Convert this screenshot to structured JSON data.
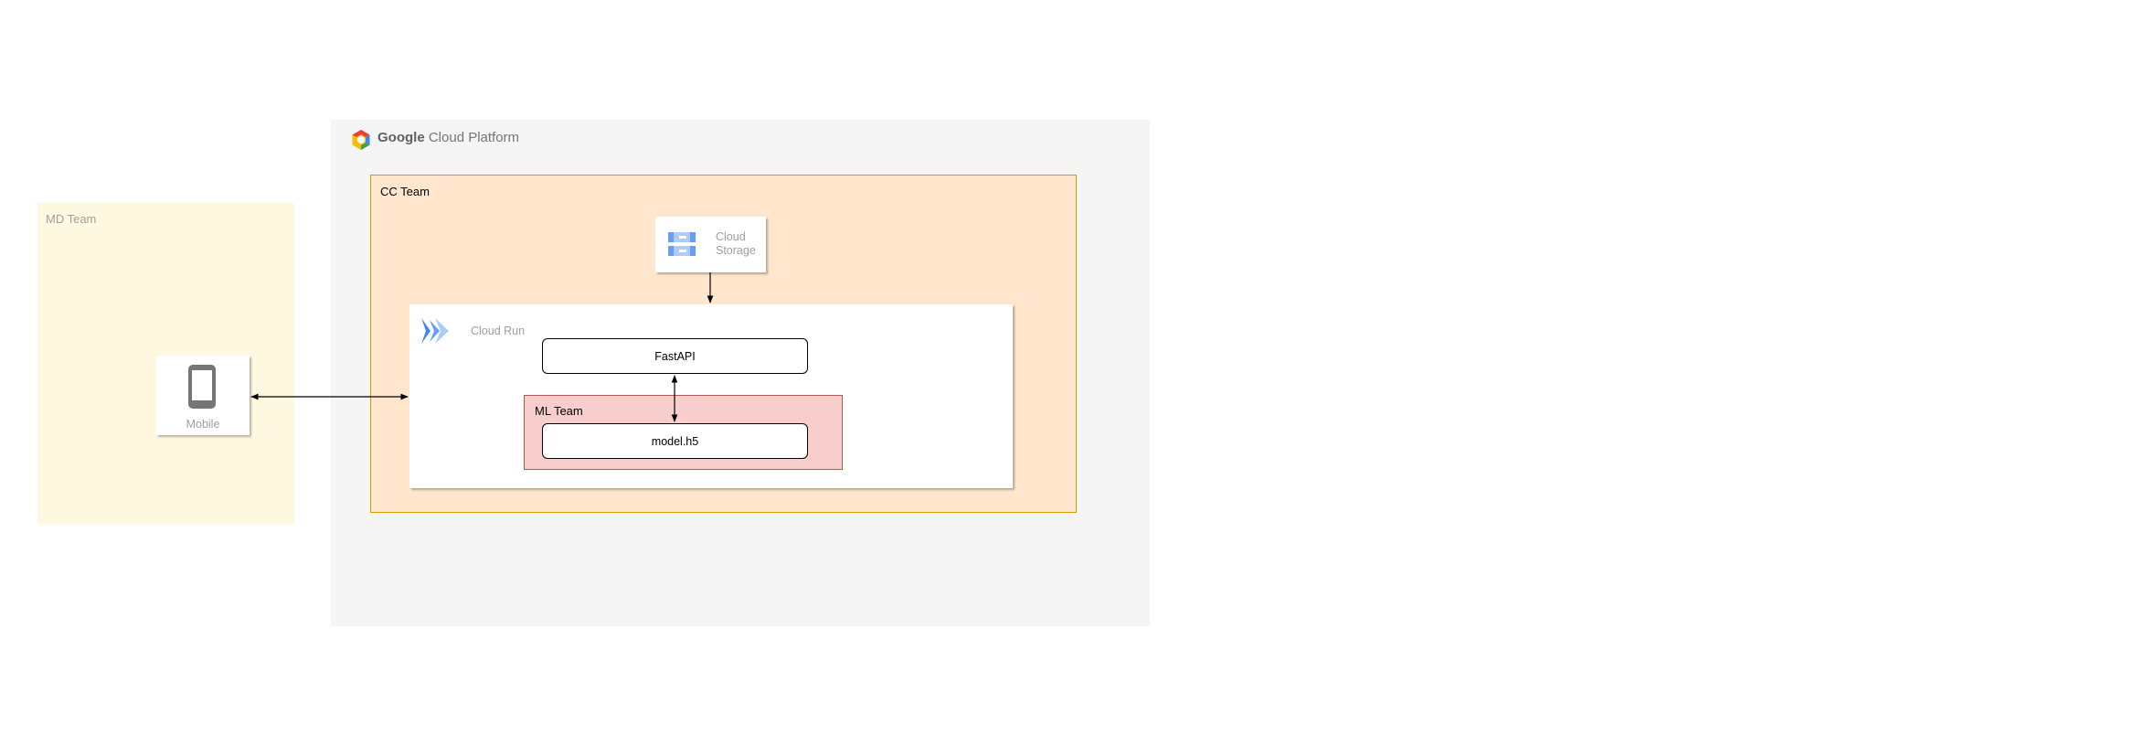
{
  "md_team": {
    "label": "MD Team"
  },
  "gcp": {
    "brand": "Google",
    "product": "Cloud Platform"
  },
  "cc_team": {
    "label": "CC Team"
  },
  "cloud_storage": {
    "label": "Cloud Storage"
  },
  "cloud_run": {
    "label": "Cloud Run"
  },
  "fastapi": {
    "label": "FastAPI"
  },
  "ml_team": {
    "label": "ML Team"
  },
  "model": {
    "label": "model.h5"
  },
  "mobile": {
    "label": "Mobile"
  },
  "colors": {
    "md_team_fill": "#fff8e1",
    "gcp_fill": "#f5f5f5",
    "cc_team_fill": "#ffe6cc",
    "cc_team_stroke": "#d79b00",
    "ml_team_fill": "#f8cecc",
    "ml_team_stroke": "#b85450",
    "icon_blue": "#4285f4",
    "icon_grey": "#757575"
  },
  "icons": [
    "gcp-logo-icon",
    "cloud-storage-icon",
    "cloud-run-icon",
    "mobile-phone-icon"
  ]
}
